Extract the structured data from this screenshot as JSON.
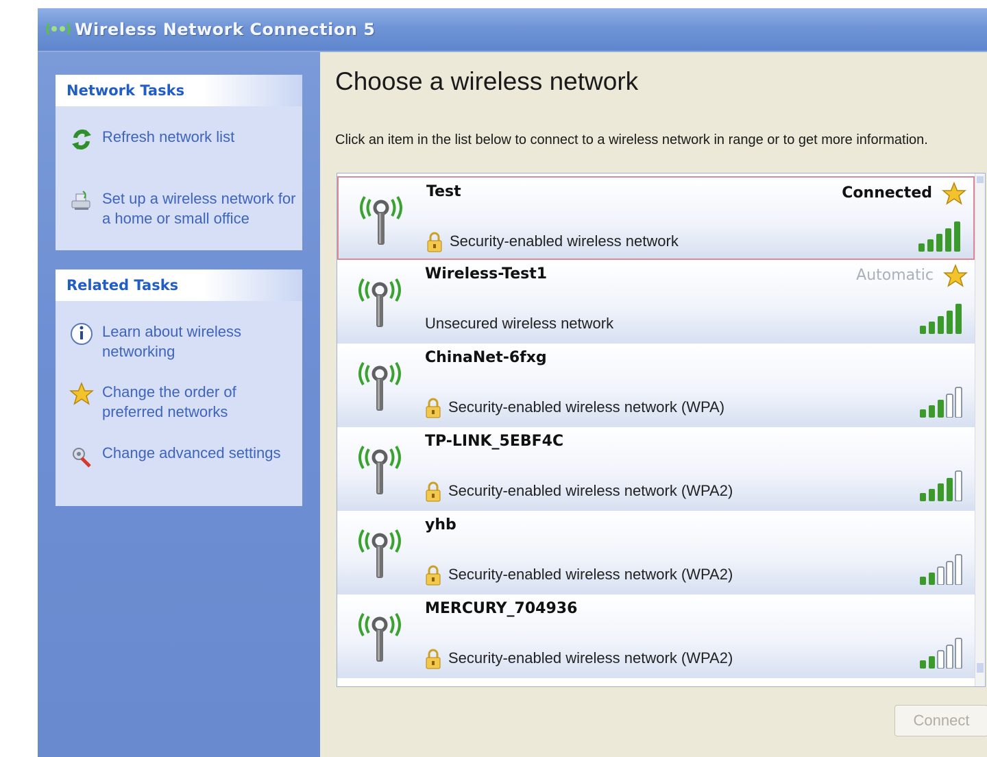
{
  "window": {
    "title": "Wireless Network Connection 5",
    "title_icon": "wireless-network-icon"
  },
  "sidebar": {
    "network_tasks": {
      "title": "Network Tasks",
      "items": [
        {
          "label": "Refresh network list",
          "icon": "refresh-icon"
        },
        {
          "label": "Set up a wireless network for a home or small office",
          "icon": "setup-network-icon"
        }
      ]
    },
    "related_tasks": {
      "title": "Related Tasks",
      "items": [
        {
          "label": "Learn about wireless networking",
          "icon": "info-icon"
        },
        {
          "label": "Change the order of preferred networks",
          "icon": "star-icon"
        },
        {
          "label": "Change advanced settings",
          "icon": "settings-icon"
        }
      ]
    }
  },
  "main": {
    "heading": "Choose a wireless network",
    "description": "Click an item in the list below to connect to a wireless network in range or to get more information.",
    "networks": [
      {
        "name": "Test",
        "security": "Security-enabled wireless network",
        "locked": true,
        "status": "Connected",
        "preferred": true,
        "signal": 5,
        "selected": true
      },
      {
        "name": "Wireless-Test1",
        "security": "Unsecured wireless network",
        "locked": false,
        "status": "Automatic",
        "preferred": true,
        "signal": 5,
        "selected": false
      },
      {
        "name": "ChinaNet-6fxg",
        "security": "Security-enabled wireless network (WPA)",
        "locked": true,
        "status": "",
        "preferred": false,
        "signal": 3,
        "selected": false
      },
      {
        "name": "TP-LINK_5EBF4C",
        "security": "Security-enabled wireless network (WPA2)",
        "locked": true,
        "status": "",
        "preferred": false,
        "signal": 4,
        "selected": false
      },
      {
        "name": "yhb",
        "security": "Security-enabled wireless network (WPA2)",
        "locked": true,
        "status": "",
        "preferred": false,
        "signal": 2,
        "selected": false
      },
      {
        "name": "MERCURY_704936",
        "security": "Security-enabled wireless network (WPA2)",
        "locked": true,
        "status": "",
        "preferred": false,
        "signal": 2,
        "selected": false
      }
    ],
    "connect_button": "Connect"
  },
  "colors": {
    "sidebar_link": "#3e64bd",
    "panel_title": "#215dc6",
    "signal_on": "#3b9a2a",
    "antenna_waves": "#3aa32f",
    "selected_border": "#d98a96"
  }
}
